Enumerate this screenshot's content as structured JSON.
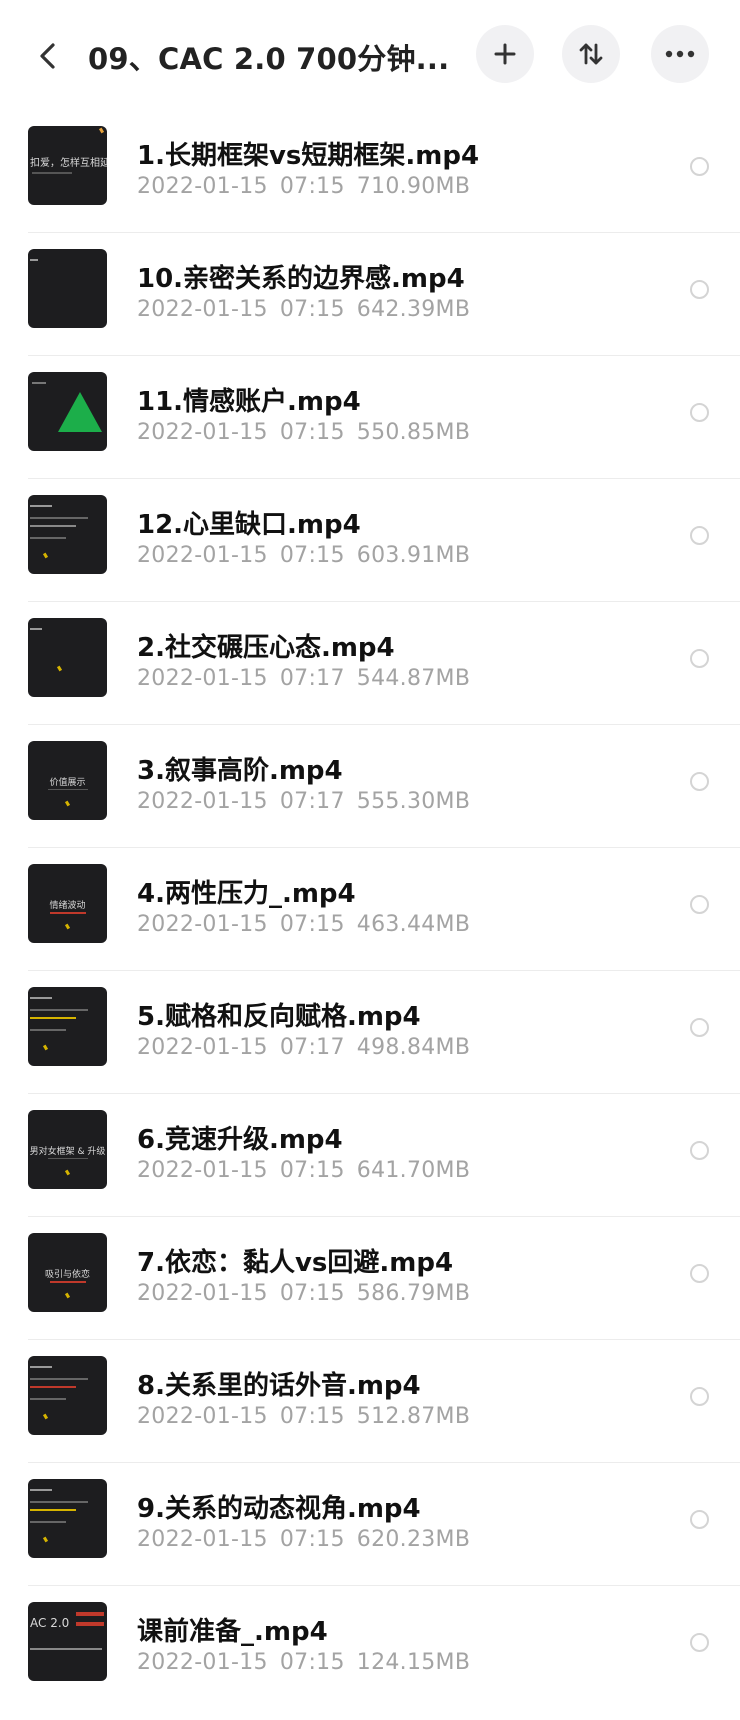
{
  "header": {
    "title": "09、CAC 2.0 700分钟...",
    "back_icon": "chevron-left-icon",
    "add_icon": "plus-icon",
    "sort_icon": "sort-icon",
    "more_icon": "more-horizontal-icon"
  },
  "files": [
    {
      "name": "1.长期框架vs短期框架.mp4",
      "date": "2022-01-15",
      "time": "07:15",
      "size": "710.90MB",
      "thumb_text": "扣爱，怎样互相延伸",
      "thumb_type": "text-top"
    },
    {
      "name": "10.亲密关系的边界感.mp4",
      "date": "2022-01-15",
      "time": "07:15",
      "size": "642.39MB",
      "thumb_text": "",
      "thumb_type": "plain"
    },
    {
      "name": "11.情感账户.mp4",
      "date": "2022-01-15",
      "time": "07:15",
      "size": "550.85MB",
      "thumb_text": "",
      "thumb_type": "triangle"
    },
    {
      "name": "12.心里缺口.mp4",
      "date": "2022-01-15",
      "time": "07:15",
      "size": "603.91MB",
      "thumb_text": "",
      "thumb_type": "lines"
    },
    {
      "name": "2.社交碾压心态.mp4",
      "date": "2022-01-15",
      "time": "07:17",
      "size": "544.87MB",
      "thumb_text": "",
      "thumb_type": "plain-accent"
    },
    {
      "name": "3.叙事高阶.mp4",
      "date": "2022-01-15",
      "time": "07:17",
      "size": "555.30MB",
      "thumb_text": "价值展示",
      "thumb_type": "center-text"
    },
    {
      "name": "4.两性压力_.mp4",
      "date": "2022-01-15",
      "time": "07:15",
      "size": "463.44MB",
      "thumb_text": "情绪波动",
      "thumb_type": "center-text-red"
    },
    {
      "name": "5.赋格和反向赋格.mp4",
      "date": "2022-01-15",
      "time": "07:17",
      "size": "498.84MB",
      "thumb_text": "",
      "thumb_type": "lines-yellow"
    },
    {
      "name": "6.竞速升级.mp4",
      "date": "2022-01-15",
      "time": "07:15",
      "size": "641.70MB",
      "thumb_text": "男对女框架 & 升级",
      "thumb_type": "center-text"
    },
    {
      "name": "7.依恋：黏人vs回避.mp4",
      "date": "2022-01-15",
      "time": "07:15",
      "size": "586.79MB",
      "thumb_text": "吸引与依恋",
      "thumb_type": "center-text-red"
    },
    {
      "name": "8.关系里的话外音.mp4",
      "date": "2022-01-15",
      "time": "07:15",
      "size": "512.87MB",
      "thumb_text": "",
      "thumb_type": "lines-red"
    },
    {
      "name": "9.关系的动态视角.mp4",
      "date": "2022-01-15",
      "time": "07:15",
      "size": "620.23MB",
      "thumb_text": "",
      "thumb_type": "lines-yellow"
    },
    {
      "name": "课前准备_.mp4",
      "date": "2022-01-15",
      "time": "07:15",
      "size": "124.15MB",
      "thumb_text": "AC 2.0",
      "thumb_type": "cac"
    }
  ]
}
